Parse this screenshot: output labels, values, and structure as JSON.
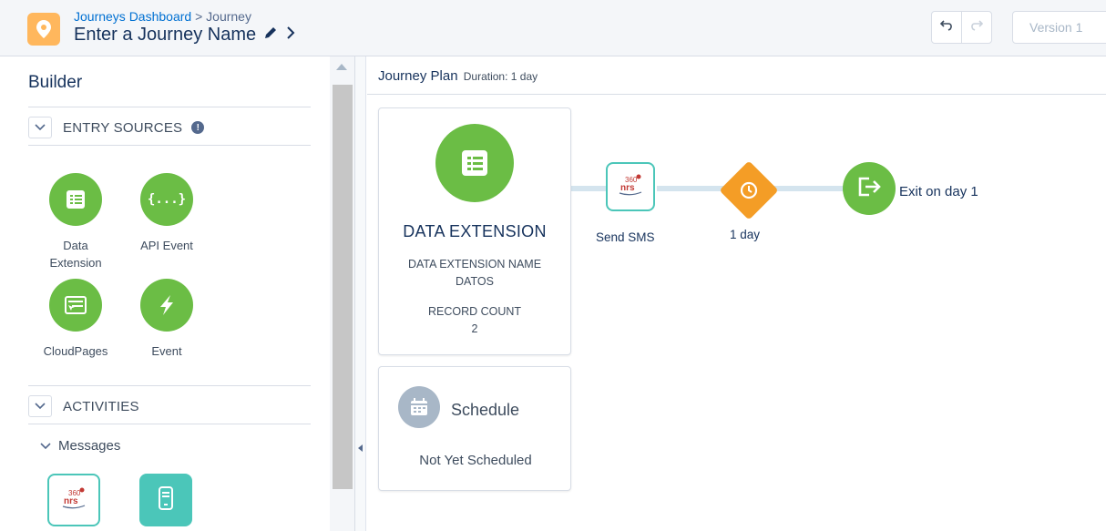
{
  "header": {
    "breadcrumb_link": "Journeys Dashboard",
    "breadcrumb_sep": ">",
    "breadcrumb_current": "Journey",
    "journey_name": "Enter a Journey Name",
    "version_label": "Version 1"
  },
  "builder": {
    "title": "Builder",
    "entry_sources_label": "ENTRY SOURCES",
    "entry_sources": [
      {
        "label": "Data Extension",
        "icon": "data-extension-icon"
      },
      {
        "label": "API Event",
        "icon": "api-event-icon"
      },
      {
        "label": "CloudPages",
        "icon": "cloudpages-icon"
      },
      {
        "label": "Event",
        "icon": "lightning-icon"
      }
    ],
    "activities_label": "ACTIVITIES",
    "messages_label": "Messages"
  },
  "canvas": {
    "plan_title": "Journey Plan",
    "plan_duration": "Duration: 1 day",
    "entry_card": {
      "title": "DATA EXTENSION",
      "name_label": "DATA EXTENSION NAME",
      "name_value": "DATOS",
      "count_label": "RECORD COUNT",
      "count_value": "2"
    },
    "schedule_card": {
      "title": "Schedule",
      "status": "Not Yet Scheduled"
    },
    "nodes": {
      "sms_label": "Send SMS",
      "wait_label": "1 day",
      "exit_label": "Exit on day 1"
    }
  },
  "colors": {
    "green": "#6bbd45",
    "orange": "#f49d26",
    "teal": "#4bc6b9",
    "logo": "#ffb75d"
  }
}
